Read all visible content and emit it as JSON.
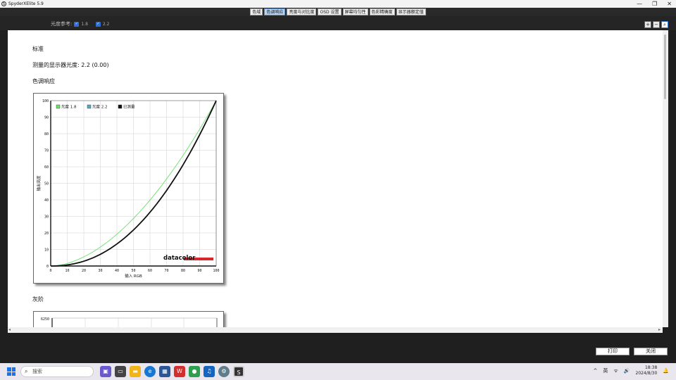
{
  "window": {
    "title": "SpyderXElite 5.9",
    "app_icon": "S",
    "controls": {
      "minimize": "—",
      "maximize": "❐",
      "close": "✕"
    }
  },
  "tabs": [
    {
      "label": "色域",
      "active": false
    },
    {
      "label": "色调响应",
      "active": true
    },
    {
      "label": "亮度与对比度",
      "active": false
    },
    {
      "label": "OSD 设置",
      "active": false
    },
    {
      "label": "屏幕均匀性",
      "active": false
    },
    {
      "label": "色彩精确度",
      "active": false
    },
    {
      "label": "显示器额定值",
      "active": false
    }
  ],
  "toolbar": {
    "gamma_ref_label": "光度参考:",
    "checkbox_1_label": "1.8",
    "checkbox_2_label": "2.2",
    "zoom_in": "+",
    "zoom_out": "−",
    "zoom_fit": "⌕"
  },
  "report": {
    "section_title": "标准",
    "measured_gamma_label": "测量的显示器光度:",
    "measured_gamma_value": "2.2 (0.00)",
    "tone_response_title": "色调响应",
    "grayscale_title": "灰阶",
    "grayscale_ytick": "6250"
  },
  "buttons": {
    "print": "打印",
    "close": "关闭"
  },
  "taskbar": {
    "search_placeholder": "搜索",
    "tray_ime": "英",
    "tray_chevron": "^",
    "tray_wifi": "ᯤ",
    "tray_volume": "🔊",
    "time": "18:38",
    "date": "2024/8/30"
  },
  "chart_data": {
    "type": "line",
    "xlabel": "输入 RGB",
    "ylabel": "输出亮度",
    "xlim": [
      0,
      100
    ],
    "ylim": [
      0,
      100
    ],
    "xticks": [
      0,
      10,
      20,
      30,
      40,
      50,
      60,
      70,
      80,
      90,
      100
    ],
    "yticks": [
      0,
      10,
      20,
      30,
      40,
      50,
      60,
      70,
      80,
      90,
      100
    ],
    "grid": true,
    "legend_position": "top-left",
    "watermark": "datacolor",
    "series": [
      {
        "name": "光度 1.8",
        "color": "#6be06b",
        "gamma": 1.8
      },
      {
        "name": "光度 2.2",
        "color": "#5aa8b8",
        "gamma": 2.2
      },
      {
        "name": "已测量",
        "color": "#111111",
        "gamma": 2.2
      }
    ]
  }
}
